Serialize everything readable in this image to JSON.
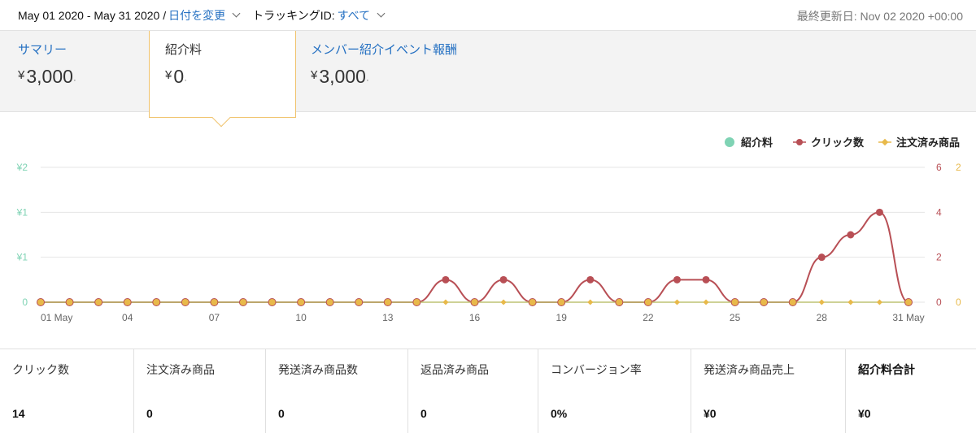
{
  "topbar": {
    "date_range": "May 01 2020 - May 31 2020 /",
    "change_date": "日付を変更",
    "tracking_label": "トラッキングID:",
    "tracking_value": "すべて",
    "last_updated": "最終更新日: Nov 02 2020 +00:00"
  },
  "summary": {
    "tabs": [
      {
        "label": "サマリー",
        "yen": "¥",
        "value": "3,000",
        "dot": "·"
      },
      {
        "label": "紹介料",
        "yen": "¥",
        "value": "0",
        "dot": "·"
      },
      {
        "label": "メンバー紹介イベント報酬",
        "yen": "¥",
        "value": "3,000",
        "dot": "·"
      }
    ]
  },
  "chart_data": {
    "type": "line",
    "legend_position": "top-right",
    "legend": [
      "紹介料",
      "クリック数",
      "注文済み商品"
    ],
    "colors": {
      "fee": "#7fd3b4",
      "clicks": "#b84f55",
      "orders": "#e8b94a",
      "grid": "#e6e6e6",
      "axis_left": "#7fd3b4",
      "axis_mid": "#b84f55",
      "axis_right": "#e8b94a"
    },
    "x_tick_labels": [
      "01 May",
      "04",
      "07",
      "10",
      "13",
      "16",
      "19",
      "22",
      "25",
      "28",
      "31 May"
    ],
    "x_tick_days": [
      1,
      4,
      7,
      10,
      13,
      16,
      19,
      22,
      25,
      28,
      31
    ],
    "x_range": [
      1,
      31
    ],
    "y_left_ticks": [
      "0",
      "¥1",
      "¥1",
      "¥2"
    ],
    "y_mid_ticks": [
      "0",
      "2",
      "4",
      "6"
    ],
    "y_right_ticks": [
      "0",
      "2"
    ],
    "y_mid_range": [
      0,
      6
    ],
    "series": [
      {
        "name": "紹介料",
        "axis": "left",
        "values": [
          0,
          0,
          0,
          0,
          0,
          0,
          0,
          0,
          0,
          0,
          0,
          0,
          0,
          0,
          0,
          0,
          0,
          0,
          0,
          0,
          0,
          0,
          0,
          0,
          0,
          0,
          0,
          0,
          0,
          0,
          0
        ]
      },
      {
        "name": "クリック数",
        "axis": "mid",
        "values": [
          0,
          0,
          0,
          0,
          0,
          0,
          0,
          0,
          0,
          0,
          0,
          0,
          0,
          0,
          1,
          0,
          1,
          0,
          0,
          1,
          0,
          0,
          1,
          1,
          0,
          0,
          0,
          2,
          3,
          4,
          0
        ]
      },
      {
        "name": "注文済み商品",
        "axis": "right",
        "values": [
          0,
          0,
          0,
          0,
          0,
          0,
          0,
          0,
          0,
          0,
          0,
          0,
          0,
          0,
          0,
          0,
          0,
          0,
          0,
          0,
          0,
          0,
          0,
          0,
          0,
          0,
          0,
          0,
          0,
          0,
          0
        ]
      }
    ]
  },
  "stats": [
    {
      "label": "クリック数",
      "value": "14"
    },
    {
      "label": "注文済み商品",
      "value": "0"
    },
    {
      "label": "発送済み商品数",
      "value": "0"
    },
    {
      "label": "返品済み商品",
      "value": "0"
    },
    {
      "label": "コンバージョン率",
      "value": "0%"
    },
    {
      "label": "発送済み商品売上",
      "value": "¥0"
    },
    {
      "label": "紹介料合計",
      "value": "¥0"
    }
  ]
}
